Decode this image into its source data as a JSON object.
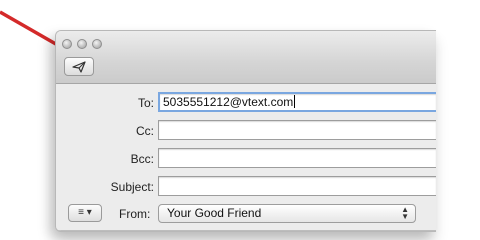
{
  "window": {
    "buttons": [
      "close",
      "minimize",
      "zoom"
    ],
    "toolbar": {
      "send_icon": "paper-plane-icon"
    }
  },
  "header_fields": {
    "to": {
      "label": "To:",
      "value": "5035551212@vtext.com"
    },
    "cc": {
      "label": "Cc:",
      "value": ""
    },
    "bcc": {
      "label": "Bcc:",
      "value": ""
    },
    "subject": {
      "label": "Subject:",
      "value": ""
    }
  },
  "from_row": {
    "format_icon": "list-icon",
    "label": "From:",
    "value": "Your Good Friend"
  },
  "colors": {
    "annotation_arrow": "#d42a2a",
    "focus_ring": "#7aa7e0"
  }
}
